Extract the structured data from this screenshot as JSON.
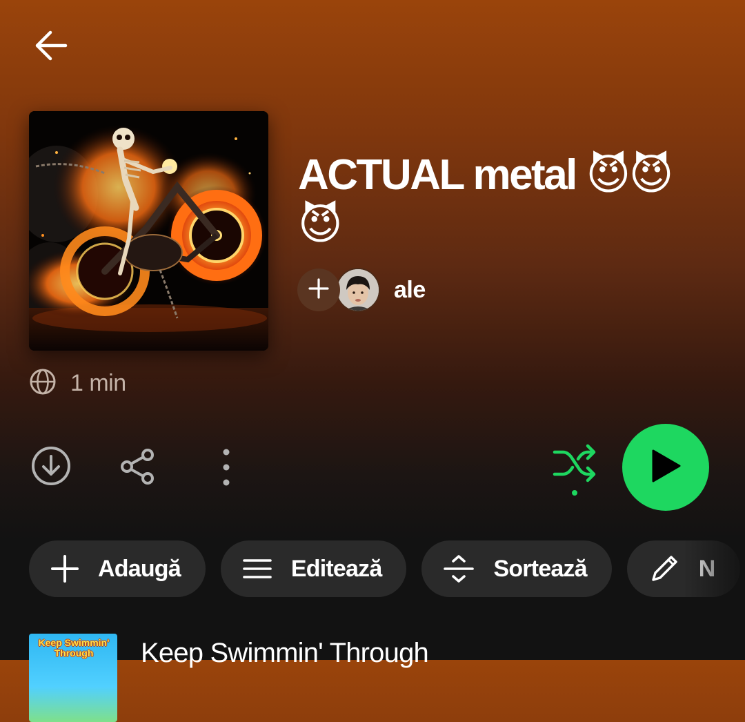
{
  "header": {
    "back_icon": "back-arrow-icon"
  },
  "playlist": {
    "title": "ACTUAL metal 😈😈😈",
    "owner": {
      "name": "ale",
      "add_icon": "plus-icon"
    },
    "visibility_icon": "globe-icon",
    "duration": "1 min"
  },
  "actions": {
    "download_icon": "download-icon",
    "share_icon": "share-icon",
    "more_icon": "more-vertical-icon",
    "shuffle_icon": "shuffle-icon",
    "play_icon": "play-icon"
  },
  "chips": [
    {
      "label": "Adaugă",
      "icon": "plus-icon"
    },
    {
      "label": "Editează",
      "icon": "menu-lines-icon"
    },
    {
      "label": "Sortează",
      "icon": "sort-icon"
    },
    {
      "label": "N",
      "icon": "pencil-icon"
    }
  ],
  "tracks": [
    {
      "title": "Keep Swimmin' Through",
      "thumb_text": "Keep Swimmin' Through"
    }
  ],
  "colors": {
    "accent": "#1ed760",
    "background": "#121212",
    "gradient_top": "#9a440b",
    "chip_bg": "#2a2a2a"
  }
}
